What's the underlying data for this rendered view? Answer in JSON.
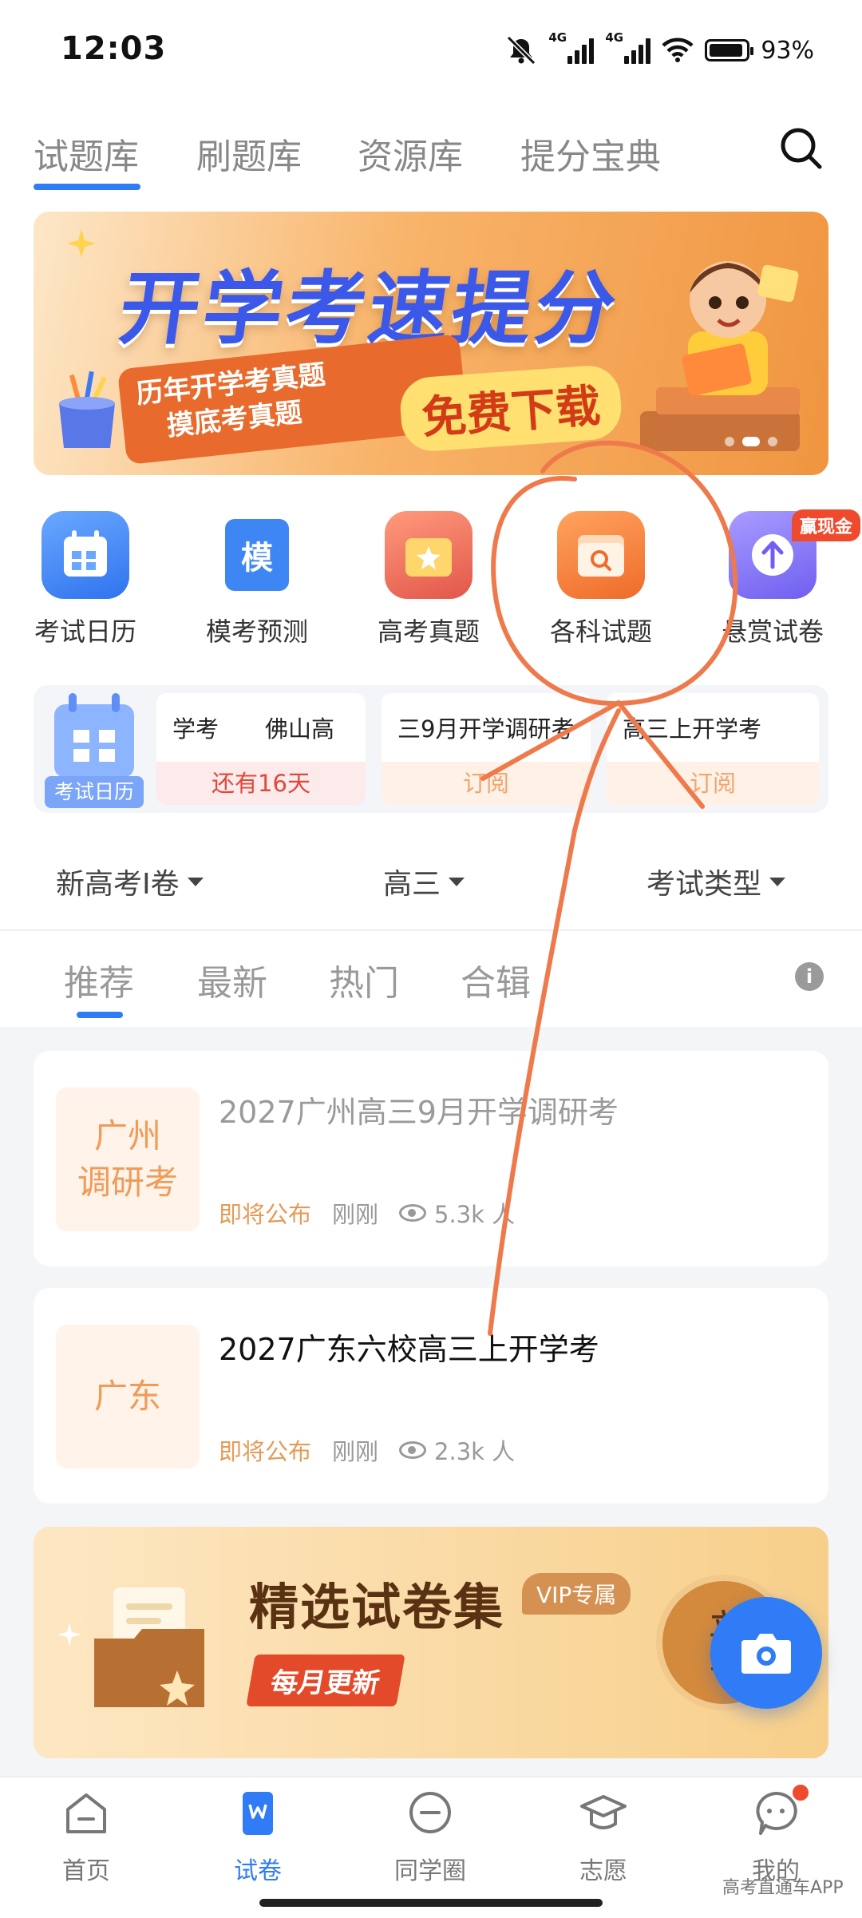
{
  "status_bar": {
    "time": "12:03",
    "net1": "4G",
    "net2": "4G",
    "battery": "93%",
    "battery_level": 0.93
  },
  "top_tabs": [
    {
      "label": "试题库",
      "active": true
    },
    {
      "label": "刷题库",
      "active": false
    },
    {
      "label": "资源库",
      "active": false
    },
    {
      "label": "提分宝典",
      "active": false
    }
  ],
  "banner": {
    "title": "开学考速提分",
    "subtitle_line1": "历年开学考真题",
    "subtitle_line2": "摸底考真题",
    "cta": "免费下载",
    "page_count": 3,
    "current_page": 2
  },
  "quick_entries": [
    {
      "label": "考试日历",
      "icon": "calendar-icon",
      "color": "#3f86f5"
    },
    {
      "label": "模考预测",
      "icon": "mock-exam-icon",
      "icon_char": "模",
      "color": "#3f86f5"
    },
    {
      "label": "高考真题",
      "icon": "star-folder-icon",
      "color": "#f07a5e"
    },
    {
      "label": "各科试题",
      "icon": "search-folder-icon",
      "color": "#f4843f"
    },
    {
      "label": "悬赏试卷",
      "icon": "upload-icon",
      "color": "#8a7cf2"
    }
  ],
  "reward_badge": "赢现金",
  "exam_calendar": {
    "label": "考试日历",
    "cards": [
      {
        "name": "学考　　佛山高",
        "footer": "还有16天",
        "type": "countdown"
      },
      {
        "name": "三9月开学调研考",
        "footer": "订阅",
        "type": "subscribe"
      },
      {
        "name": "高三上开学考",
        "footer": "订阅",
        "type": "subscribe"
      }
    ]
  },
  "filters": [
    {
      "label": "新高考Ⅰ卷"
    },
    {
      "label": "高三"
    },
    {
      "label": "考试类型"
    }
  ],
  "sub_tabs": [
    {
      "label": "推荐",
      "active": true
    },
    {
      "label": "最新",
      "active": false
    },
    {
      "label": "热门",
      "active": false
    },
    {
      "label": "合辑",
      "active": false
    }
  ],
  "papers": [
    {
      "thumb_line1": "广州",
      "thumb_line2": "调研考",
      "title": "2027广州高三9月开学调研考",
      "status": "即将公布",
      "time": "刚刚",
      "views": "5.3k 人",
      "title_color": "#9a9a9a"
    },
    {
      "thumb_line1": "广东",
      "thumb_line2": "",
      "title": "2027广东六校高三上开学考",
      "status": "即将公布",
      "time": "刚刚",
      "views": "2.3k 人",
      "title_color": "#111111"
    }
  ],
  "promo": {
    "title": "精选试卷集",
    "vip_tag": "VIP专属",
    "monthly": "每月更新",
    "cta_line1": "立",
    "cta_line2": "查"
  },
  "bottom_nav": [
    {
      "label": "首页",
      "icon": "home-icon",
      "active": false
    },
    {
      "label": "试卷",
      "icon": "paper-icon",
      "active": true
    },
    {
      "label": "同学圈",
      "icon": "chat-circle-icon",
      "active": false
    },
    {
      "label": "志愿",
      "icon": "graduation-cap-icon",
      "active": false
    },
    {
      "label": "我的",
      "icon": "profile-icon",
      "active": false
    }
  ],
  "watermark": "高考直通车APP",
  "colors": {
    "accent": "#2f7cf6",
    "annotation": "#ee7a4c",
    "soon": "#e59b57",
    "countdown": "#e0483b"
  }
}
